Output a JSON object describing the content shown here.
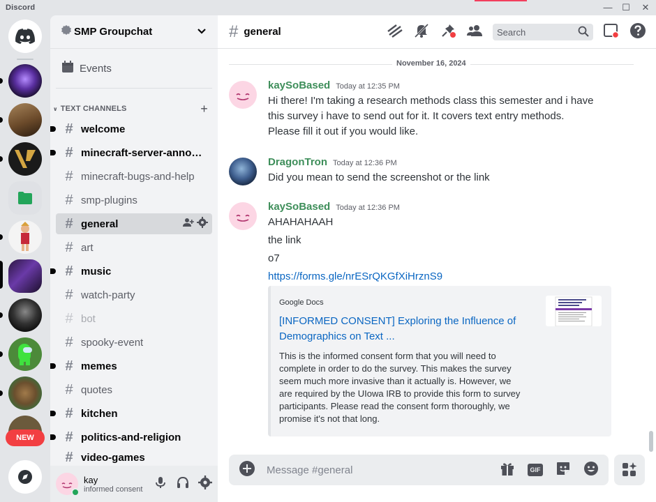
{
  "window": {
    "app_title": "Discord"
  },
  "rail": {
    "new_badge": "NEW"
  },
  "sidebar": {
    "server_name": "SMP Groupchat",
    "events_label": "Events",
    "category": "TEXT CHANNELS",
    "channels": [
      {
        "name": "welcome",
        "state": "unread"
      },
      {
        "name": "minecraft-server-announcements",
        "state": "unread"
      },
      {
        "name": "minecraft-bugs-and-help",
        "state": "read"
      },
      {
        "name": "smp-plugins",
        "state": "read"
      },
      {
        "name": "general",
        "state": "active"
      },
      {
        "name": "art",
        "state": "read"
      },
      {
        "name": "music",
        "state": "unread"
      },
      {
        "name": "watch-party",
        "state": "read"
      },
      {
        "name": "bot",
        "state": "muted"
      },
      {
        "name": "spooky-event",
        "state": "read"
      },
      {
        "name": "memes",
        "state": "unread"
      },
      {
        "name": "quotes",
        "state": "read"
      },
      {
        "name": "kitchen",
        "state": "unread"
      },
      {
        "name": "politics-and-religion",
        "state": "unread"
      },
      {
        "name": "video-games",
        "state": "unread"
      }
    ],
    "user": {
      "name": "kay",
      "status": "informed consent"
    }
  },
  "main": {
    "channel_title": "general",
    "search_placeholder": "Search",
    "date_divider": "November 16, 2024",
    "messages": [
      {
        "author": "kaySoBased",
        "time": "Today at 12:35 PM",
        "lines": [
          "Hi there! I'm taking a research methods class this semester and i have",
          "this survey i have to send out for it. It covers text entry methods.",
          "Please fill it out if you would like."
        ]
      },
      {
        "author": "DragonTron",
        "time": "Today at 12:36 PM",
        "lines": [
          "Did you mean to send the screenshot or the link"
        ]
      },
      {
        "author": "kaySoBased",
        "time": "Today at 12:36 PM",
        "lines": [
          "AHAHAHAAH",
          "the link",
          "o7"
        ],
        "link": "https://forms.gle/nrESrQKGfXiHrznS9"
      }
    ],
    "embed": {
      "provider": "Google Docs",
      "title_line1": "[INFORMED CONSENT] Exploring the Influence of",
      "title_line2": "Demographics on Text ...",
      "desc_lines": [
        "This is the informed consent form that you will need to",
        "complete in order to do the survey. This makes the survey",
        "seem much more invasive than it actually is. However, we",
        "are required by the UIowa IRB to provide this form to survey",
        "participants. Please read the consent form thoroughly, we",
        "promise it's not that long."
      ]
    },
    "composer_placeholder": "Message #general",
    "gif_label": "GIF"
  },
  "colors": {
    "author": "#3e8e5a",
    "link": "#0a66c2",
    "badge": "#f23f42",
    "online": "#23a55a"
  }
}
